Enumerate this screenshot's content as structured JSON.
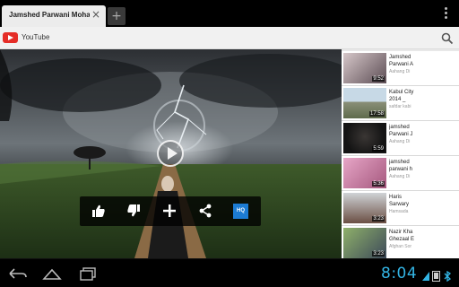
{
  "browser": {
    "tab_title": "Jamshed Parwani Moha…",
    "tab_close": "×",
    "new_tab": "+"
  },
  "app": {
    "name": "YouTube"
  },
  "player": {
    "quality_label": "HQ"
  },
  "related": [
    {
      "title_line1": "Jamshed",
      "title_line2": "Parwani A",
      "channel": "Aahang Di",
      "duration": "9:52"
    },
    {
      "title_line1": "Kabul City",
      "title_line2": "2014 _",
      "channel": "safdar kabi",
      "duration": "17:58"
    },
    {
      "title_line1": "jamshed",
      "title_line2": "Parwani J",
      "channel": "Aahang Di",
      "duration": "5:59"
    },
    {
      "title_line1": "jamshed",
      "title_line2": "parwani h",
      "channel": "Aahang Di",
      "duration": "5:36"
    },
    {
      "title_line1": "Haris",
      "title_line2": "Sarwary",
      "channel": "Hamsada",
      "duration": "3:23"
    },
    {
      "title_line1": "Nazir Kha",
      "title_line2": "Ghezaal E",
      "channel": "Afghan Sor",
      "duration": "3:23"
    }
  ],
  "statusbar": {
    "clock": "8:04",
    "accent_color": "#33b5e5"
  },
  "icons": {
    "like": "thumbs-up-icon",
    "dislike": "thumbs-down-icon",
    "add": "plus-icon",
    "share": "share-icon",
    "search": "search-icon",
    "back": "back-icon",
    "home": "home-icon",
    "recents": "recents-icon"
  }
}
